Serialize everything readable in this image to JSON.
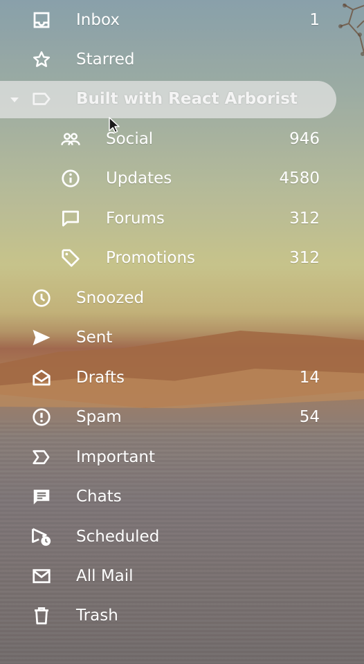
{
  "theme": {
    "text_color": "#ffffff",
    "selected_bg": "#e4e4e4"
  },
  "folders": [
    {
      "label": "Inbox",
      "count": "1",
      "icon": "inbox-icon"
    },
    {
      "label": "Starred",
      "count": "",
      "icon": "star-icon"
    },
    {
      "label": "Built with React Arborist",
      "count": "",
      "icon": "label-icon",
      "expanded": true,
      "selected": true
    },
    {
      "label": "Social",
      "count": "946",
      "icon": "people-icon",
      "nested": true
    },
    {
      "label": "Updates",
      "count": "4580",
      "icon": "info-icon",
      "nested": true
    },
    {
      "label": "Forums",
      "count": "312",
      "icon": "forum-icon",
      "nested": true
    },
    {
      "label": "Promotions",
      "count": "312",
      "icon": "tag-icon",
      "nested": true
    },
    {
      "label": "Snoozed",
      "count": "",
      "icon": "clock-icon"
    },
    {
      "label": "Sent",
      "count": "",
      "icon": "send-icon"
    },
    {
      "label": "Drafts",
      "count": "14",
      "icon": "drafts-icon"
    },
    {
      "label": "Spam",
      "count": "54",
      "icon": "spam-icon"
    },
    {
      "label": "Important",
      "count": "",
      "icon": "important-icon"
    },
    {
      "label": "Chats",
      "count": "",
      "icon": "chat-icon"
    },
    {
      "label": "Scheduled",
      "count": "",
      "icon": "scheduled-icon"
    },
    {
      "label": "All Mail",
      "count": "",
      "icon": "mail-icon"
    },
    {
      "label": "Trash",
      "count": "",
      "icon": "trash-icon"
    }
  ]
}
